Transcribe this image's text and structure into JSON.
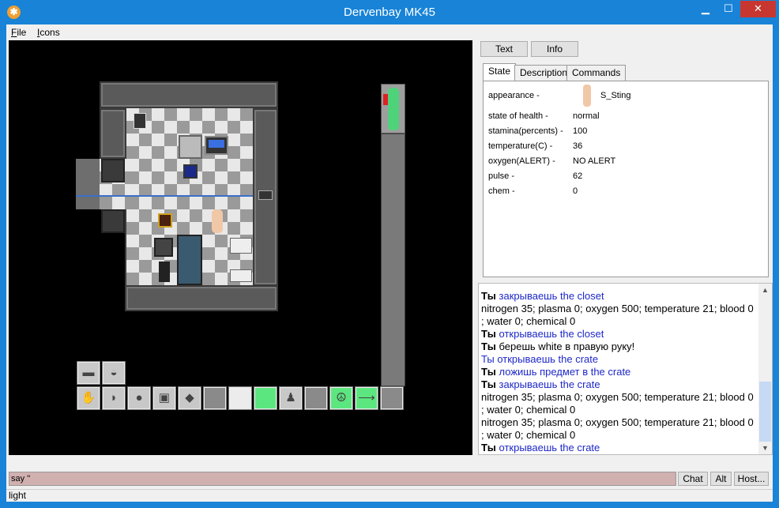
{
  "window": {
    "title": "Dervenbay MK45",
    "min_glyph": "▁",
    "max_glyph": "☐",
    "close_glyph": "✕"
  },
  "menu": {
    "file_first": "F",
    "file_rest": "ile",
    "icons_first": "I",
    "icons_rest": "cons"
  },
  "panel": {
    "text_button": "Text",
    "info_button": "Info",
    "tabs": [
      "State",
      "Description",
      "Commands"
    ],
    "state": [
      {
        "label": "appearance -",
        "value": "S_Sting"
      },
      {
        "label": "state of health -",
        "value": "normal"
      },
      {
        "label": "stamina(percents) -",
        "value": "100"
      },
      {
        "label": "temperature(C) -",
        "value": "36"
      },
      {
        "label": "oxygen(ALERT) -",
        "value": "NO ALERT"
      },
      {
        "label": "pulse -",
        "value": "62"
      },
      {
        "label": "chem -",
        "value": "0"
      }
    ]
  },
  "log": [
    {
      "bold": "Ты",
      "rest": "закрываешь the closet",
      "style": "blue"
    },
    {
      "bold": "",
      "rest": "nitrogen 35; plasma 0; oxygen 500; temperature 21; blood 0",
      "style": "black"
    },
    {
      "bold": "",
      "rest": "; water 0; chemical 0",
      "style": "black"
    },
    {
      "bold": "Ты",
      "rest": "открываешь the closet",
      "style": "blue"
    },
    {
      "bold": "Ты",
      "rest": "берешь white в правую руку!",
      "style": "black"
    },
    {
      "bold": "",
      "rest": "Ты открываешь the crate",
      "style": "blue"
    },
    {
      "bold": "Ты",
      "rest": "ложишь предмет в the crate",
      "style": "blue"
    },
    {
      "bold": "Ты",
      "rest": "закрываешь the crate",
      "style": "blue"
    },
    {
      "bold": "",
      "rest": "nitrogen 35; plasma 0; oxygen 500; temperature 21; blood 0",
      "style": "black"
    },
    {
      "bold": "",
      "rest": "; water 0; chemical 0",
      "style": "black"
    },
    {
      "bold": "",
      "rest": "nitrogen 35; plasma 0; oxygen 500; temperature 21; blood 0",
      "style": "black"
    },
    {
      "bold": "",
      "rest": "; water 0; chemical 0",
      "style": "black"
    },
    {
      "bold": "Ты",
      "rest": "открываешь the crate",
      "style": "blue"
    }
  ],
  "input": {
    "command": "say ''",
    "chat_button": "Chat",
    "alt_button": "Alt",
    "host_button": "Host..."
  },
  "status": {
    "text": "light"
  },
  "hud": {
    "peace_glyph": "☮",
    "arrow_glyph": "⟶"
  },
  "colors": {
    "title_bar": "#1883d7",
    "close_button": "#c7372f",
    "input_bg": "#d1b0b0",
    "hud_green": "#5ce67f",
    "log_blue": "#1e28c8"
  }
}
